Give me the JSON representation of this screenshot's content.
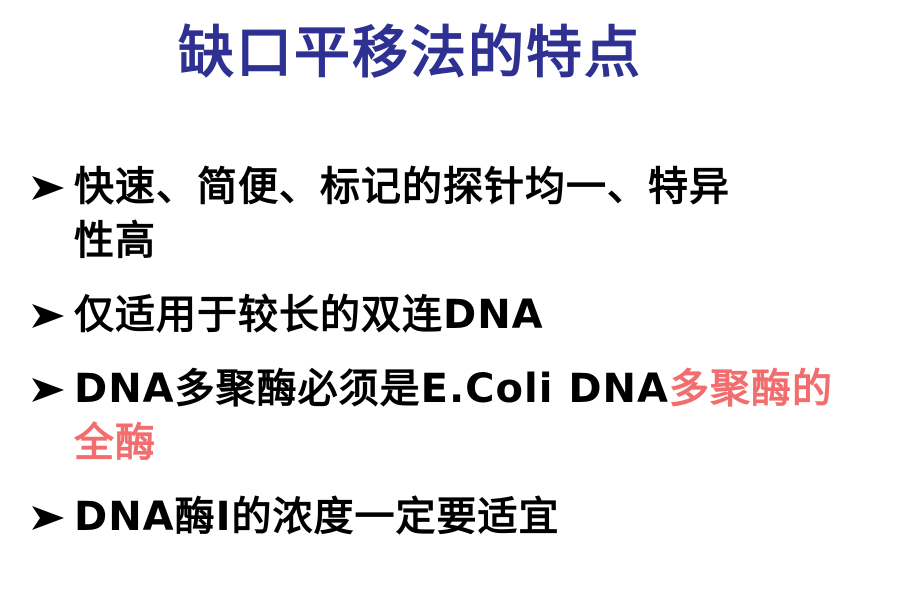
{
  "slide": {
    "title": "缺口平移法的特点",
    "bullets": [
      {
        "lines": [
          [
            {
              "text": "快速、简便、标记的探针均一、特异",
              "color": "text"
            }
          ],
          [
            {
              "text": "性高",
              "color": "text"
            }
          ]
        ]
      },
      {
        "lines": [
          [
            {
              "text": "仅适用于较长的双连DNA",
              "color": "text"
            }
          ]
        ]
      },
      {
        "lines": [
          [
            {
              "text": "DNA多聚酶必须是E.Coli DNA",
              "color": "text"
            },
            {
              "text": "多聚酶的",
              "color": "highlight"
            }
          ],
          [
            {
              "text": "全酶",
              "color": "highlight"
            }
          ]
        ]
      },
      {
        "lines": [
          [
            {
              "text": "DNA酶I的浓度一定要适宜",
              "color": "text"
            }
          ]
        ]
      }
    ],
    "bullet_icon": "arrowhead-bullet-icon"
  },
  "colors": {
    "title": "#2E3192",
    "text": "#000000",
    "highlight": "#F26D6D",
    "background": "#FFFFFF"
  }
}
